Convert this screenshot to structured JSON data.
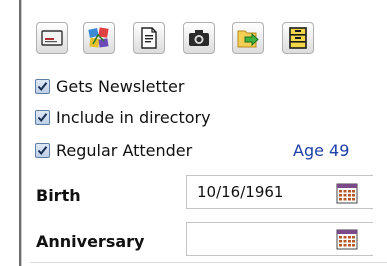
{
  "toolbar": {
    "buttons": [
      {
        "name": "contact-card",
        "icon": "contact-card-icon"
      },
      {
        "name": "photo-collage",
        "icon": "photo-collage-icon"
      },
      {
        "name": "document",
        "icon": "document-icon"
      },
      {
        "name": "camera",
        "icon": "camera-icon"
      },
      {
        "name": "export",
        "icon": "export-arrow-icon"
      },
      {
        "name": "archive",
        "icon": "archive-drawer-icon"
      }
    ]
  },
  "options": {
    "newsletter_label": "Gets Newsletter",
    "newsletter_checked": true,
    "directory_label": "Include in directory",
    "directory_checked": true,
    "attender_label": "Regular Attender",
    "attender_checked": true,
    "age_text": "Age 49"
  },
  "birth": {
    "label": "Birth",
    "value": "10/16/1961"
  },
  "anniversary": {
    "label": "Anniversary",
    "value": ""
  },
  "colors": {
    "accent": "#1d3fa8",
    "checkbox_border": "#5d7fa6"
  }
}
